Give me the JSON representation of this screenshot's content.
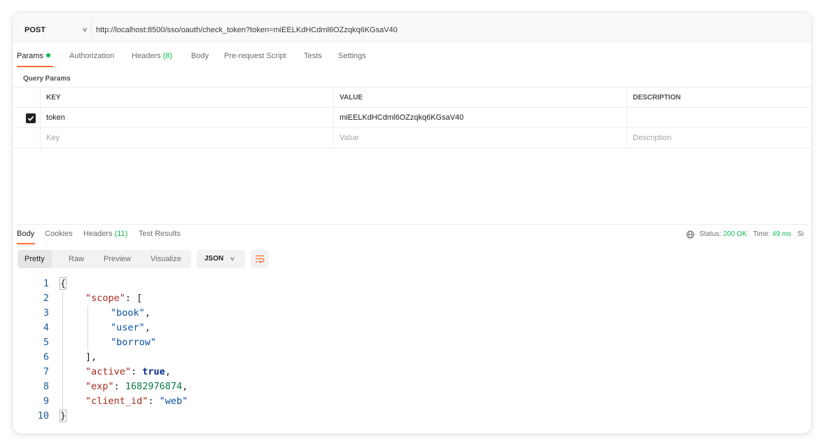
{
  "request": {
    "method": "POST",
    "url": "http://localhost:8500/sso/oauth/check_token?token=miEELKdHCdml6OZzqkq6KGsaV40"
  },
  "request_tabs": {
    "params": "Params",
    "authorization": "Authorization",
    "headers": "Headers",
    "headers_count": "(8)",
    "body": "Body",
    "prerequest": "Pre-request Script",
    "tests": "Tests",
    "settings": "Settings"
  },
  "query_params": {
    "section_label": "Query Params",
    "columns": {
      "key": "KEY",
      "value": "VALUE",
      "description": "DESCRIPTION"
    },
    "rows": [
      {
        "checked": true,
        "key": "token",
        "value": "miEELKdHCdml6OZzqkq6KGsaV40",
        "description": ""
      }
    ],
    "placeholders": {
      "key": "Key",
      "value": "Value",
      "description": "Description"
    }
  },
  "response_tabs": {
    "body": "Body",
    "cookies": "Cookies",
    "headers": "Headers",
    "headers_count": "(11)",
    "test_results": "Test Results"
  },
  "response_status": {
    "status_label": "Status:",
    "status_value": "200 OK",
    "time_label": "Time:",
    "time_value": "49 ms",
    "size_label_partial": "Si"
  },
  "view_toolbar": {
    "pretty": "Pretty",
    "raw": "Raw",
    "preview": "Preview",
    "visualize": "Visualize",
    "format": "JSON"
  },
  "response_body": {
    "lines": [
      "1",
      "2",
      "3",
      "4",
      "5",
      "6",
      "7",
      "8",
      "9",
      "10"
    ],
    "scope_key": "\"scope\"",
    "scope_values": [
      "\"book\"",
      "\"user\"",
      "\"borrow\""
    ],
    "active_key": "\"active\"",
    "active_value": "true",
    "exp_key": "\"exp\"",
    "exp_value": "1682976874",
    "client_id_key": "\"client_id\"",
    "client_id_value": "\"web\""
  },
  "colors": {
    "accent": "#ff6c37",
    "success": "#0cbb52",
    "json_key": "#a8271d",
    "json_string": "#0a4fa6",
    "json_number": "#0a7b42"
  },
  "icons": [
    "chevron-down-icon",
    "checkbox-checked-icon",
    "globe-icon",
    "wrap-lines-icon"
  ]
}
